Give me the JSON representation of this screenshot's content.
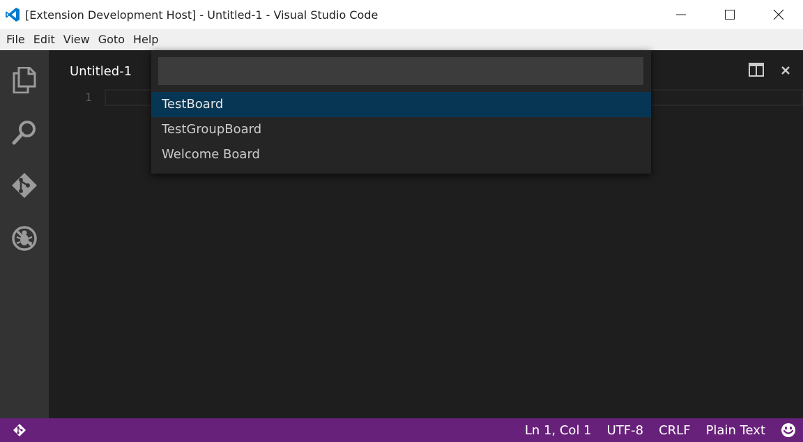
{
  "window": {
    "title": "[Extension Development Host] - Untitled-1 - Visual Studio Code",
    "app_icon": "vscode-logo-icon",
    "controls": [
      "minimize-icon",
      "maximize-icon",
      "close-icon"
    ]
  },
  "menu": {
    "items": [
      "File",
      "Edit",
      "View",
      "Goto",
      "Help"
    ]
  },
  "activity_bar": {
    "items": [
      {
        "icon": "explorer-files-icon"
      },
      {
        "icon": "search-icon"
      },
      {
        "icon": "git-icon"
      },
      {
        "icon": "debug-icon"
      }
    ]
  },
  "editor": {
    "tab_title": "Untitled-1",
    "line_numbers": [
      "1"
    ],
    "actions": [
      "split-editor-icon",
      "close-editor-icon"
    ]
  },
  "quick_pick": {
    "input_value": "",
    "input_placeholder": "",
    "items": [
      {
        "label": "TestBoard",
        "selected": true
      },
      {
        "label": "TestGroupBoard",
        "selected": false
      },
      {
        "label": "Welcome Board",
        "selected": false
      }
    ]
  },
  "status_bar": {
    "left_icon": "git-branch-icon",
    "position": "Ln 1, Col 1",
    "encoding": "UTF-8",
    "line_ending": "CRLF",
    "language": "Plain Text",
    "feedback_icon": "smiley-feedback-icon"
  },
  "colors": {
    "status_bar": "#68217a",
    "selection": "#073655",
    "activity_bar": "#333333",
    "editor_bg": "#1e1e1e",
    "vscode_blue": "#007acc"
  }
}
